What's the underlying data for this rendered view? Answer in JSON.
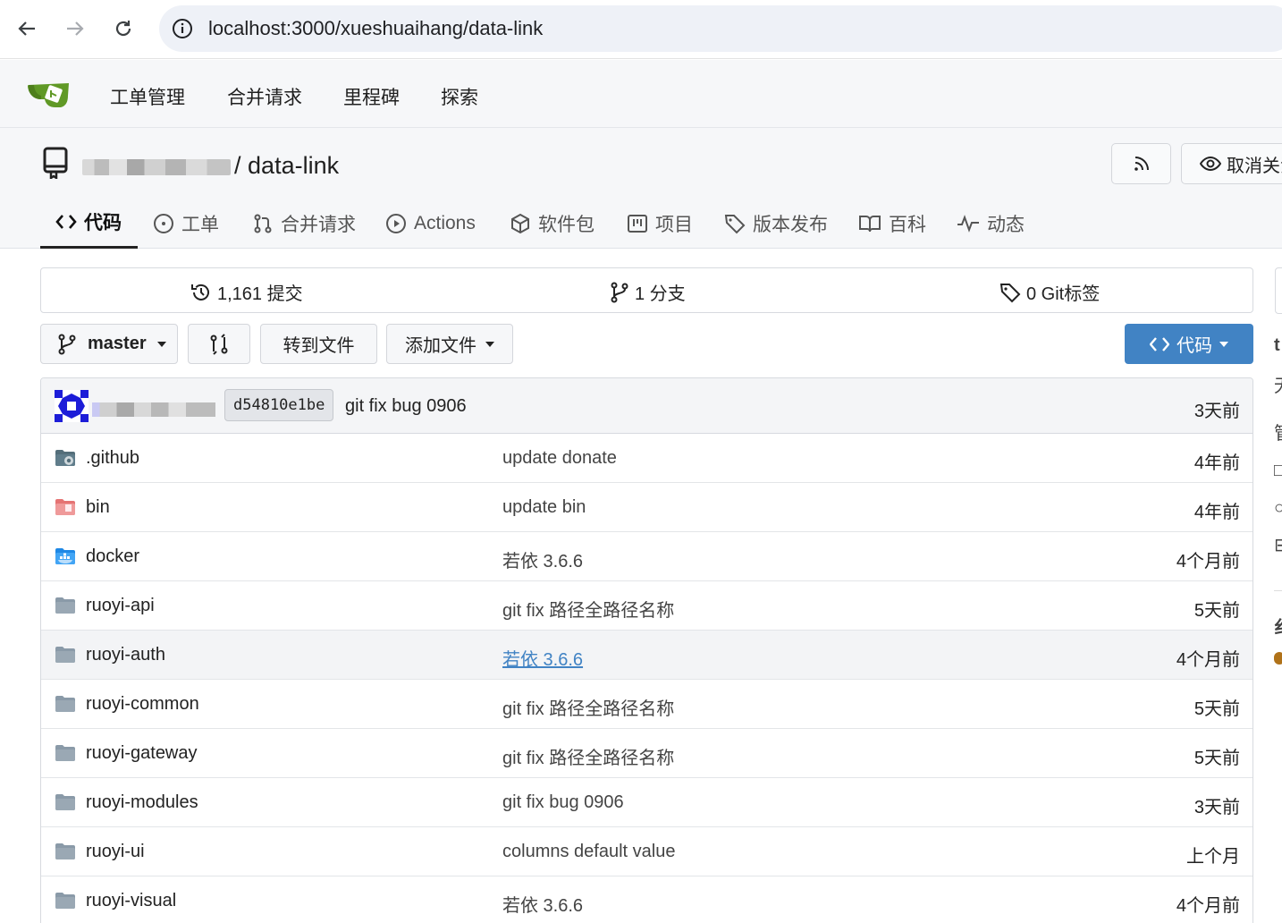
{
  "browser": {
    "url": "localhost:3000/xueshuaihang/data-link"
  },
  "topnav": {
    "items": [
      "工单管理",
      "合并请求",
      "里程碑",
      "探索"
    ]
  },
  "repo": {
    "name": "data-link",
    "separator": "/",
    "watch_label": "取消关注",
    "tabs": [
      {
        "label": "代码",
        "icon": "code-icon"
      },
      {
        "label": "工单",
        "icon": "issue-icon"
      },
      {
        "label": "合并请求",
        "icon": "pull-request-icon"
      },
      {
        "label": "Actions",
        "icon": "play-icon"
      },
      {
        "label": "软件包",
        "icon": "package-icon"
      },
      {
        "label": "项目",
        "icon": "project-icon"
      },
      {
        "label": "版本发布",
        "icon": "tag-icon"
      },
      {
        "label": "百科",
        "icon": "book-icon"
      },
      {
        "label": "动态",
        "icon": "pulse-icon"
      }
    ]
  },
  "stats": {
    "commits": "1,161 提交",
    "branches": "1 分支",
    "tags": "0 Git标签"
  },
  "actions": {
    "branch": "master",
    "goto_file": "转到文件",
    "add_file": "添加文件",
    "code": "代码"
  },
  "last_commit": {
    "sha": "d54810e1be",
    "message": "git fix bug 0906",
    "time": "3天前"
  },
  "files": [
    {
      "name": ".github",
      "message": "update donate",
      "time": "4年前",
      "icon": "folder-github-icon"
    },
    {
      "name": "bin",
      "message": "update bin",
      "time": "4年前",
      "icon": "folder-bin-icon"
    },
    {
      "name": "docker",
      "message": "若依 3.6.6",
      "time": "4个月前",
      "icon": "folder-docker-icon"
    },
    {
      "name": "ruoyi-api",
      "message": "git fix 路径全路径名称",
      "time": "5天前",
      "icon": "folder-icon"
    },
    {
      "name": "ruoyi-auth",
      "message": "若依 3.6.6",
      "time": "4个月前",
      "icon": "folder-icon"
    },
    {
      "name": "ruoyi-common",
      "message": "git fix 路径全路径名称",
      "time": "5天前",
      "icon": "folder-icon"
    },
    {
      "name": "ruoyi-gateway",
      "message": "git fix 路径全路径名称",
      "time": "5天前",
      "icon": "folder-icon"
    },
    {
      "name": "ruoyi-modules",
      "message": "git fix bug 0906",
      "time": "3天前",
      "icon": "folder-icon"
    },
    {
      "name": "ruoyi-ui",
      "message": "columns default value",
      "time": "上个月",
      "icon": "folder-icon"
    },
    {
      "name": "ruoyi-visual",
      "message": "若依 3.6.6",
      "time": "4个月前",
      "icon": "folder-icon"
    }
  ],
  "colors": {
    "accent": "#4183c4",
    "folder": "#8a9aa8",
    "logo_green": "#609926"
  }
}
